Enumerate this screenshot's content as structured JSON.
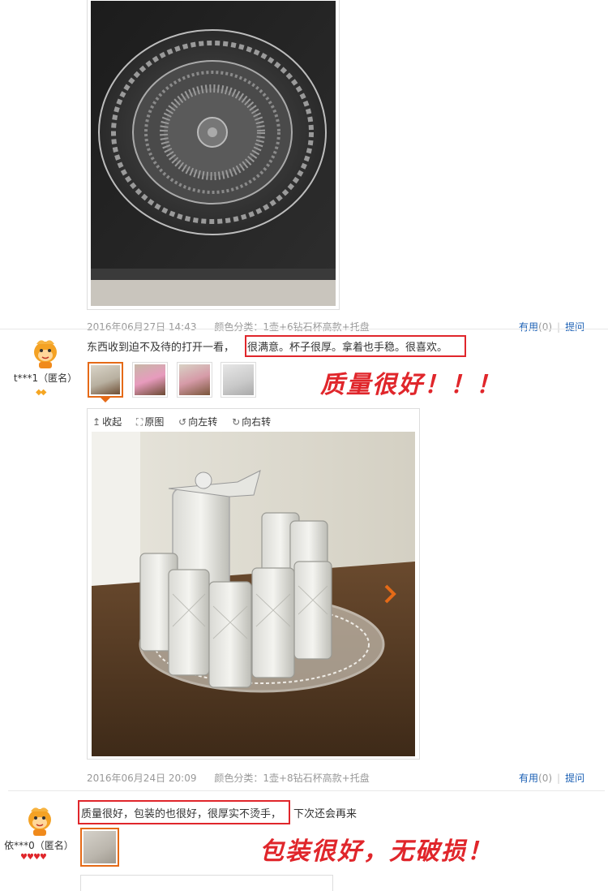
{
  "review_top": {
    "date": "2016年06月27日 14:43",
    "sku_label": "颜色分类：",
    "sku_value": "1壶+6钻石杯高款+托盘",
    "useful_label": "有用",
    "useful_count": "(0)",
    "reply_label": "提问"
  },
  "review1": {
    "username": "t***1（匿名）",
    "comment_pre": "东西收到迫不及待的打开一看，",
    "comment_hl": "很满意。杯子很厚。拿着也手稳。很喜欢。",
    "annotation": "质量很好！！！",
    "toolbar": {
      "collapse": "收起",
      "original": "原图",
      "rotate_left": "向左转",
      "rotate_right": "向右转"
    },
    "date": "2016年06月24日 20:09",
    "sku_label": "颜色分类：",
    "sku_value": "1壶+8钻石杯高款+托盘",
    "useful_label": "有用",
    "useful_count": "(0)",
    "reply_label": "提问"
  },
  "review2": {
    "username": "依***0（匿名）",
    "comment_hl": "质量很好，包装的也很好，很厚实不烫手，",
    "comment_post": "下次还会再来",
    "annotation": "包装很好，无破损！"
  },
  "icons": [
    "avatar-mascot",
    "diamond-icon",
    "heart-icon",
    "chevron-right-icon",
    "collapse-icon",
    "fullsize-icon",
    "rotate-left-icon",
    "rotate-right-icon"
  ],
  "colors": {
    "highlight_red": "#e0262b",
    "active_orange": "#e56a17",
    "link_blue": "#1a5fb4"
  }
}
